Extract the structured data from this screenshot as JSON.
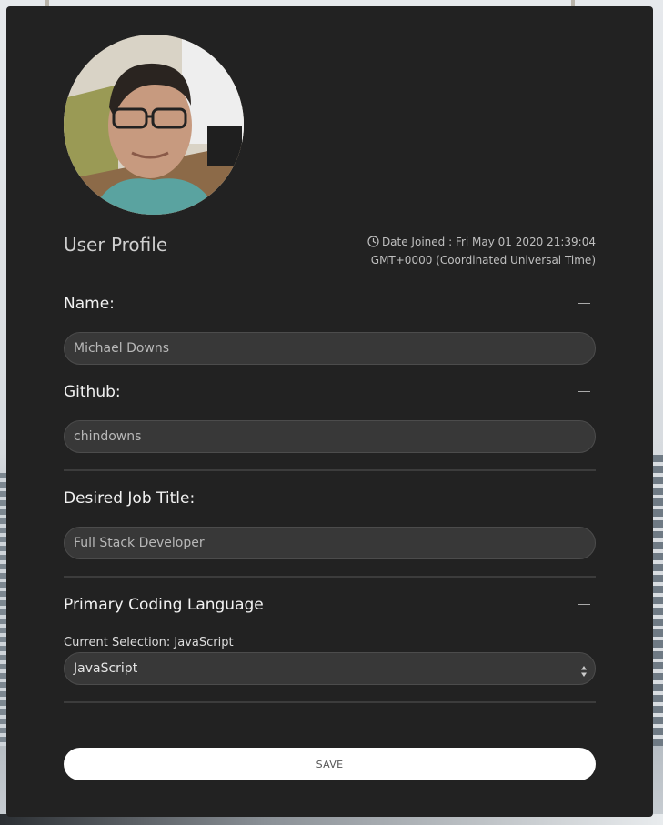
{
  "profile": {
    "title": "User Profile",
    "date_joined_line1": "Date Joined : Fri May 01 2020 21:39:04",
    "date_joined_line2": "GMT+0000 (Coordinated Universal Time)",
    "avatar_icon": "user-photo"
  },
  "fields": {
    "name": {
      "label": "Name:",
      "value": "Michael Downs"
    },
    "github": {
      "label": "Github:",
      "value": "chindowns"
    },
    "job_title": {
      "label": "Desired Job Title:",
      "value": "Full Stack Developer"
    },
    "language": {
      "label": "Primary Coding Language",
      "current_selection": "Current Selection: JavaScript",
      "selected": "JavaScript"
    }
  },
  "actions": {
    "save_label": "SAVE"
  },
  "colors": {
    "card_bg": "#222222",
    "field_bg": "#383838",
    "button_bg": "#ffffff",
    "text_primary": "#f2f2f2",
    "text_muted": "#bfbfbf"
  }
}
